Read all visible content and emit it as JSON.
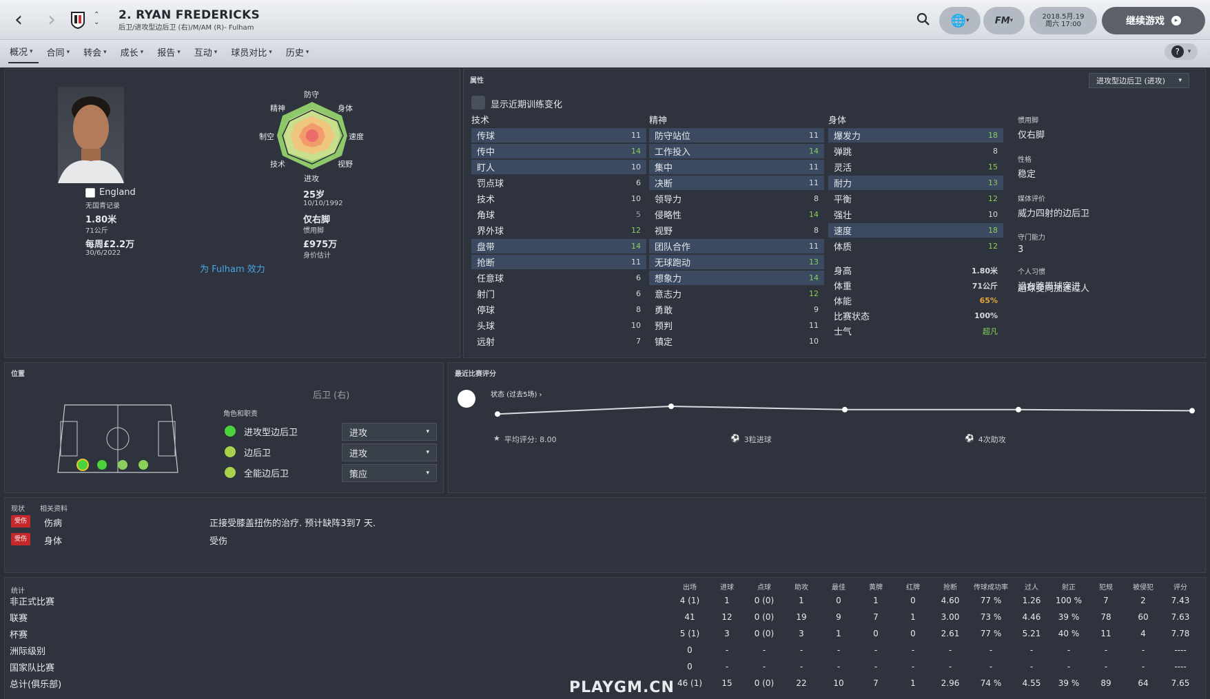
{
  "header": {
    "title": "2. RYAN FREDERICKS",
    "subtitle": "后卫/进攻型边后卫 (右)/M/AM (R)- Fulham",
    "date": "2018.5月.19",
    "time": "周六 17:00",
    "continue": "继续游戏"
  },
  "tabs": [
    {
      "label": "概况"
    },
    {
      "label": "合同"
    },
    {
      "label": "转会"
    },
    {
      "label": "成长"
    },
    {
      "label": "报告"
    },
    {
      "label": "互动"
    },
    {
      "label": "球员对比"
    },
    {
      "label": "历史"
    }
  ],
  "profile": {
    "nation": "England",
    "youth": "无国青记录",
    "height": "1.80米",
    "weight": "71公斤",
    "wage": "每周£2.2万",
    "contract_end": "30/6/2022",
    "age": "25岁",
    "dob": "10/10/1992",
    "foot": "仅右脚",
    "foot_label": "惯用脚",
    "value": "£975万",
    "value_label": "身价估计",
    "plays_for": "为 Fulham 效力"
  },
  "hex": {
    "top": "防守",
    "tl": "精神",
    "tr": "身体",
    "l": "制空",
    "r": "速度",
    "bl": "技术",
    "br": "视野",
    "bottom": "进攻"
  },
  "attributes": {
    "title": "属性",
    "show_changes": "显示近期训练变化",
    "role_select": "进攻型边后卫 (进攻)",
    "tech_title": "技术",
    "mental_title": "精神",
    "phys_title": "身体",
    "technical": [
      {
        "n": "传球",
        "v": "11",
        "h": true
      },
      {
        "n": "传中",
        "v": "14",
        "h": true
      },
      {
        "n": "盯人",
        "v": "10",
        "h": true
      },
      {
        "n": "罚点球",
        "v": "6"
      },
      {
        "n": "技术",
        "v": "10"
      },
      {
        "n": "角球",
        "v": "5"
      },
      {
        "n": "界外球",
        "v": "12"
      },
      {
        "n": "盘带",
        "v": "14",
        "h": true
      },
      {
        "n": "抢断",
        "v": "11",
        "h": true
      },
      {
        "n": "任意球",
        "v": "6"
      },
      {
        "n": "射门",
        "v": "6"
      },
      {
        "n": "停球",
        "v": "8"
      },
      {
        "n": "头球",
        "v": "10"
      },
      {
        "n": "远射",
        "v": "7"
      }
    ],
    "mental": [
      {
        "n": "防守站位",
        "v": "11",
        "h": true
      },
      {
        "n": "工作投入",
        "v": "14",
        "h": true
      },
      {
        "n": "集中",
        "v": "11",
        "h": true
      },
      {
        "n": "决断",
        "v": "11",
        "h": true
      },
      {
        "n": "领导力",
        "v": "8"
      },
      {
        "n": "侵略性",
        "v": "14"
      },
      {
        "n": "视野",
        "v": "8"
      },
      {
        "n": "团队合作",
        "v": "11",
        "h": true
      },
      {
        "n": "无球跑动",
        "v": "13",
        "h": true
      },
      {
        "n": "想象力",
        "v": "14",
        "h": true
      },
      {
        "n": "意志力",
        "v": "12"
      },
      {
        "n": "勇敢",
        "v": "9"
      },
      {
        "n": "预判",
        "v": "11"
      },
      {
        "n": "镇定",
        "v": "10"
      }
    ],
    "physical": [
      {
        "n": "爆发力",
        "v": "18",
        "h": true
      },
      {
        "n": "弹跳",
        "v": "8"
      },
      {
        "n": "灵活",
        "v": "15"
      },
      {
        "n": "耐力",
        "v": "13",
        "h": true
      },
      {
        "n": "平衡",
        "v": "12"
      },
      {
        "n": "强壮",
        "v": "10"
      },
      {
        "n": "速度",
        "v": "18",
        "h": true
      },
      {
        "n": "体质",
        "v": "12"
      }
    ],
    "body": [
      {
        "n": "身高",
        "v": "1.80米"
      },
      {
        "n": "体重",
        "v": "71公斤"
      },
      {
        "n": "体能",
        "v": "65%"
      },
      {
        "n": "比赛状态",
        "v": "100%"
      },
      {
        "n": "士气",
        "v": "超凡"
      }
    ],
    "side": [
      {
        "k": "惯用脚",
        "v": "仅右脚"
      },
      {
        "k": "性格",
        "v": "稳定"
      },
      {
        "k": "媒体评价",
        "v": "威力四射的边后卫"
      },
      {
        "k": "守门能力",
        "v": "3"
      },
      {
        "k": "个人习惯",
        "v": "沿右路带球突进"
      },
      {
        "k": "",
        "v": "趟球变向加速过人"
      }
    ]
  },
  "position": {
    "title": "位置",
    "pos": "后卫 (右)",
    "roles_title": "角色和职责",
    "roles": [
      {
        "n": "进攻型边后卫",
        "d": "进攻"
      },
      {
        "n": "边后卫",
        "d": "进攻"
      },
      {
        "n": "全能边后卫",
        "d": "策应"
      }
    ]
  },
  "form": {
    "title": "最近比赛评分",
    "label": "状态 (过去5场) ›",
    "avg": "平均评分: 8.00",
    "goals": "3粒进球",
    "assists": "4次助攻",
    "ratings": [
      7.3,
      8.0,
      7.7,
      7.7,
      7.6
    ]
  },
  "status": {
    "t1": "现状",
    "t2": "相关资料",
    "rows": [
      {
        "badge": "受伤",
        "k": "伤病",
        "v": "正接受膝盖扭伤的治疗. 预计缺阵3到7 天."
      },
      {
        "badge": "受伤",
        "k": "身体",
        "v": "受伤"
      }
    ]
  },
  "stats": {
    "title": "统计",
    "cols": [
      "出场",
      "进球",
      "点球",
      "助攻",
      "最佳",
      "黄牌",
      "红牌",
      "抢断",
      "传球成功率",
      "过人",
      "射正",
      "犯规",
      "被侵犯",
      "评分"
    ],
    "rows": [
      {
        "n": "非正式比赛",
        "c": [
          "4 (1)",
          "1",
          "0 (0)",
          "1",
          "0",
          "1",
          "0",
          "4.60",
          "77 %",
          "1.26",
          "100 %",
          "7",
          "2",
          "7.43"
        ]
      },
      {
        "n": "联赛",
        "c": [
          "41",
          "12",
          "0 (0)",
          "19",
          "9",
          "7",
          "1",
          "3.00",
          "73 %",
          "4.46",
          "39 %",
          "78",
          "60",
          "7.63"
        ]
      },
      {
        "n": "杯赛",
        "c": [
          "5 (1)",
          "3",
          "0 (0)",
          "3",
          "1",
          "0",
          "0",
          "2.61",
          "77 %",
          "5.21",
          "40 %",
          "11",
          "4",
          "7.78"
        ]
      },
      {
        "n": "洲际级别",
        "c": [
          "0",
          "-",
          "-",
          "-",
          "-",
          "-",
          "-",
          "-",
          "-",
          "-",
          "-",
          "-",
          "-",
          "----"
        ]
      },
      {
        "n": "国家队比赛",
        "c": [
          "0",
          "-",
          "-",
          "-",
          "-",
          "-",
          "-",
          "-",
          "-",
          "-",
          "-",
          "-",
          "-",
          "----"
        ]
      },
      {
        "n": "总计(俱乐部)",
        "c": [
          "46 (1)",
          "15",
          "0 (0)",
          "22",
          "10",
          "7",
          "1",
          "2.96",
          "74 %",
          "4.55",
          "39 %",
          "89",
          "64",
          "7.65"
        ]
      }
    ]
  },
  "watermark": "PLAYGM.CN"
}
